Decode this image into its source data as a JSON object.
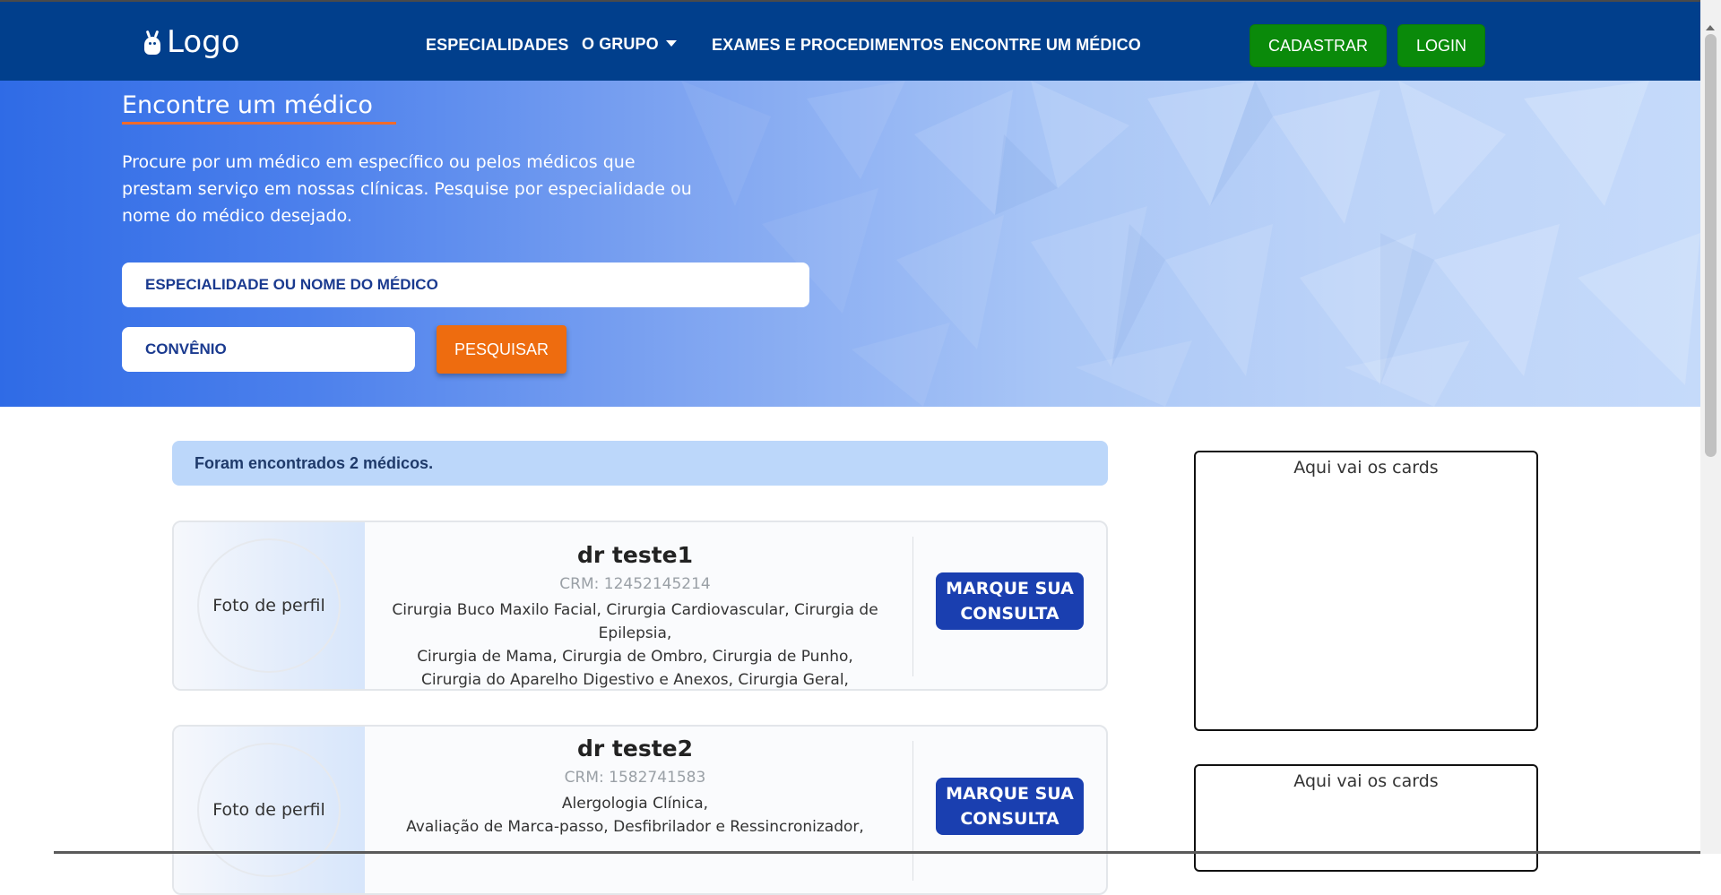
{
  "navbar": {
    "logo_text": "Logo",
    "links": [
      "ESPECIALIDADES",
      "O GRUPO",
      "EXAMES E PROCEDIMENTOS",
      "ENCONTRE UM MÉDICO"
    ],
    "register_label": "CADASTRAR",
    "login_label": "LOGIN"
  },
  "hero": {
    "title": "Encontre um médico",
    "description": "Procure por um médico em específico ou pelos médicos que prestam serviço em nossas clínicas. Pesquise por especialidade ou nome do médico desejado.",
    "search_placeholder": "ESPECIALIDADE OU NOME DO MÉDICO",
    "insurance_placeholder": "CONVÊNIO",
    "search_button": "PESQUISAR"
  },
  "results": {
    "summary": "Foram encontrados 2 médicos."
  },
  "doctors": [
    {
      "photo_label": "Foto de perfil",
      "name": "dr teste1",
      "crm": "CRM: 12452145214",
      "specialties": [
        "Cirurgia Buco Maxilo Facial, Cirurgia Cardiovascular, Cirurgia de Epilepsia,",
        "Cirurgia de Mama, Cirurgia de Ombro, Cirurgia de Punho,",
        "Cirurgia do Aparelho Digestivo e Anexos, Cirurgia Geral,"
      ],
      "button_label": "MARQUE SUA CONSULTA"
    },
    {
      "photo_label": "Foto de perfil",
      "name": "dr teste2",
      "crm": "CRM: 1582741583",
      "specialties": [
        "Alergologia Clínica,",
        "Avaliação de Marca-passo, Desfibrilador e Ressincronizador,"
      ],
      "button_label": "MARQUE SUA CONSULTA"
    }
  ],
  "sidebar": {
    "cards": [
      "Aqui vai os cards",
      "Aqui vai os cards"
    ]
  },
  "colors": {
    "navbar": "#013f8c",
    "green_button": "#0a8a0a",
    "orange_button": "#ee6c0f",
    "blue_button": "#1a3fb0",
    "alert_bg": "#bcd7fa"
  }
}
